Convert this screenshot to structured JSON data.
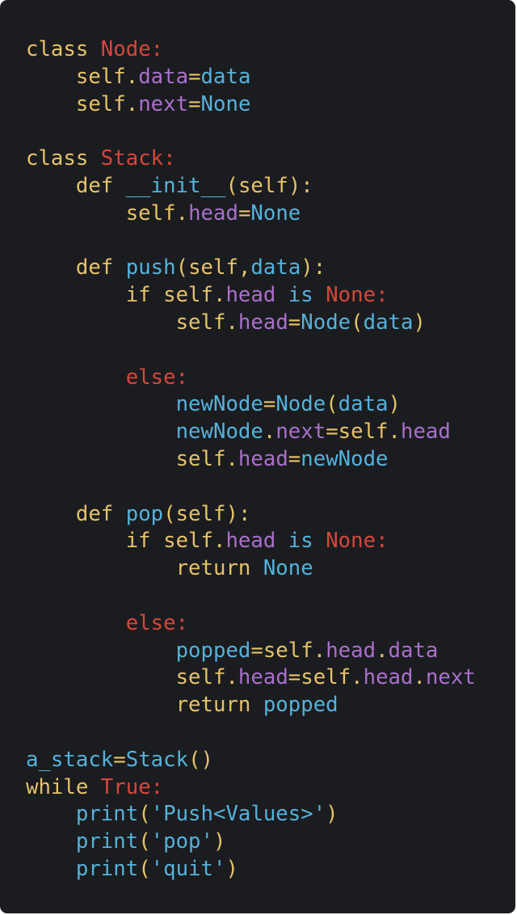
{
  "colors": {
    "background": "#1b1c1f",
    "keyword": "#e6c36a",
    "identifier": "#54b2dc",
    "attribute": "#a970cc",
    "punctuation": "#e6c36a",
    "red_keyword": "#d6473c",
    "plain": "#d9d9d9"
  },
  "code": {
    "language": "python",
    "lines": [
      [
        [
          "class ",
          "keyword"
        ],
        [
          "Node:",
          "red_keyword"
        ]
      ],
      [
        [
          "    self",
          "keyword"
        ],
        [
          ".",
          "punctuation"
        ],
        [
          "data",
          "attribute"
        ],
        [
          "=",
          "punctuation"
        ],
        [
          "data",
          "identifier"
        ]
      ],
      [
        [
          "    self",
          "keyword"
        ],
        [
          ".",
          "punctuation"
        ],
        [
          "next",
          "attribute"
        ],
        [
          "=",
          "punctuation"
        ],
        [
          "None",
          "identifier"
        ]
      ],
      [],
      [
        [
          "class ",
          "keyword"
        ],
        [
          "Stack:",
          "red_keyword"
        ]
      ],
      [
        [
          "    def ",
          "keyword"
        ],
        [
          "__init__",
          "identifier"
        ],
        [
          "(",
          "punctuation"
        ],
        [
          "self",
          "keyword"
        ],
        [
          "):",
          "punctuation"
        ]
      ],
      [
        [
          "        self",
          "keyword"
        ],
        [
          ".",
          "punctuation"
        ],
        [
          "head",
          "attribute"
        ],
        [
          "=",
          "punctuation"
        ],
        [
          "None",
          "identifier"
        ]
      ],
      [],
      [
        [
          "    def ",
          "keyword"
        ],
        [
          "push",
          "identifier"
        ],
        [
          "(",
          "punctuation"
        ],
        [
          "self",
          "keyword"
        ],
        [
          ",",
          "punctuation"
        ],
        [
          "data",
          "identifier"
        ],
        [
          "):",
          "punctuation"
        ]
      ],
      [
        [
          "        if ",
          "keyword"
        ],
        [
          "self",
          "keyword"
        ],
        [
          ".",
          "punctuation"
        ],
        [
          "head",
          "attribute"
        ],
        [
          " is ",
          "identifier"
        ],
        [
          "None:",
          "red_keyword"
        ]
      ],
      [
        [
          "            self",
          "keyword"
        ],
        [
          ".",
          "punctuation"
        ],
        [
          "head",
          "attribute"
        ],
        [
          "=",
          "punctuation"
        ],
        [
          "Node",
          "identifier"
        ],
        [
          "(",
          "punctuation"
        ],
        [
          "data",
          "identifier"
        ],
        [
          ")",
          "punctuation"
        ]
      ],
      [],
      [
        [
          "        else:",
          "red_keyword"
        ]
      ],
      [
        [
          "            newNode",
          "identifier"
        ],
        [
          "=",
          "punctuation"
        ],
        [
          "Node",
          "identifier"
        ],
        [
          "(",
          "punctuation"
        ],
        [
          "data",
          "identifier"
        ],
        [
          ")",
          "punctuation"
        ]
      ],
      [
        [
          "            newNode",
          "identifier"
        ],
        [
          ".",
          "punctuation"
        ],
        [
          "next",
          "attribute"
        ],
        [
          "=",
          "punctuation"
        ],
        [
          "self",
          "keyword"
        ],
        [
          ".",
          "punctuation"
        ],
        [
          "head",
          "attribute"
        ]
      ],
      [
        [
          "            self",
          "keyword"
        ],
        [
          ".",
          "punctuation"
        ],
        [
          "head",
          "attribute"
        ],
        [
          "=",
          "punctuation"
        ],
        [
          "newNode",
          "identifier"
        ]
      ],
      [],
      [
        [
          "    def ",
          "keyword"
        ],
        [
          "pop",
          "identifier"
        ],
        [
          "(",
          "punctuation"
        ],
        [
          "self",
          "keyword"
        ],
        [
          "):",
          "punctuation"
        ]
      ],
      [
        [
          "        if ",
          "keyword"
        ],
        [
          "self",
          "keyword"
        ],
        [
          ".",
          "punctuation"
        ],
        [
          "head",
          "attribute"
        ],
        [
          " is ",
          "identifier"
        ],
        [
          "None:",
          "red_keyword"
        ]
      ],
      [
        [
          "            return ",
          "keyword"
        ],
        [
          "None",
          "identifier"
        ]
      ],
      [],
      [
        [
          "        else:",
          "red_keyword"
        ]
      ],
      [
        [
          "            popped",
          "identifier"
        ],
        [
          "=",
          "punctuation"
        ],
        [
          "self",
          "keyword"
        ],
        [
          ".",
          "punctuation"
        ],
        [
          "head",
          "attribute"
        ],
        [
          ".",
          "punctuation"
        ],
        [
          "data",
          "attribute"
        ]
      ],
      [
        [
          "            self",
          "keyword"
        ],
        [
          ".",
          "punctuation"
        ],
        [
          "head",
          "attribute"
        ],
        [
          "=",
          "punctuation"
        ],
        [
          "self",
          "keyword"
        ],
        [
          ".",
          "punctuation"
        ],
        [
          "head",
          "attribute"
        ],
        [
          ".",
          "punctuation"
        ],
        [
          "next",
          "attribute"
        ]
      ],
      [
        [
          "            return ",
          "keyword"
        ],
        [
          "popped",
          "identifier"
        ]
      ],
      [],
      [
        [
          "a_stack",
          "identifier"
        ],
        [
          "=",
          "punctuation"
        ],
        [
          "Stack",
          "identifier"
        ],
        [
          "()",
          "punctuation"
        ]
      ],
      [
        [
          "while ",
          "keyword"
        ],
        [
          "True:",
          "red_keyword"
        ]
      ],
      [
        [
          "    print",
          "identifier"
        ],
        [
          "(",
          "punctuation"
        ],
        [
          "'Push<Values>'",
          "identifier"
        ],
        [
          ")",
          "punctuation"
        ]
      ],
      [
        [
          "    print",
          "identifier"
        ],
        [
          "(",
          "punctuation"
        ],
        [
          "'pop'",
          "identifier"
        ],
        [
          ")",
          "punctuation"
        ]
      ],
      [
        [
          "    print",
          "identifier"
        ],
        [
          "(",
          "punctuation"
        ],
        [
          "'quit'",
          "identifier"
        ],
        [
          ")",
          "punctuation"
        ]
      ]
    ]
  }
}
